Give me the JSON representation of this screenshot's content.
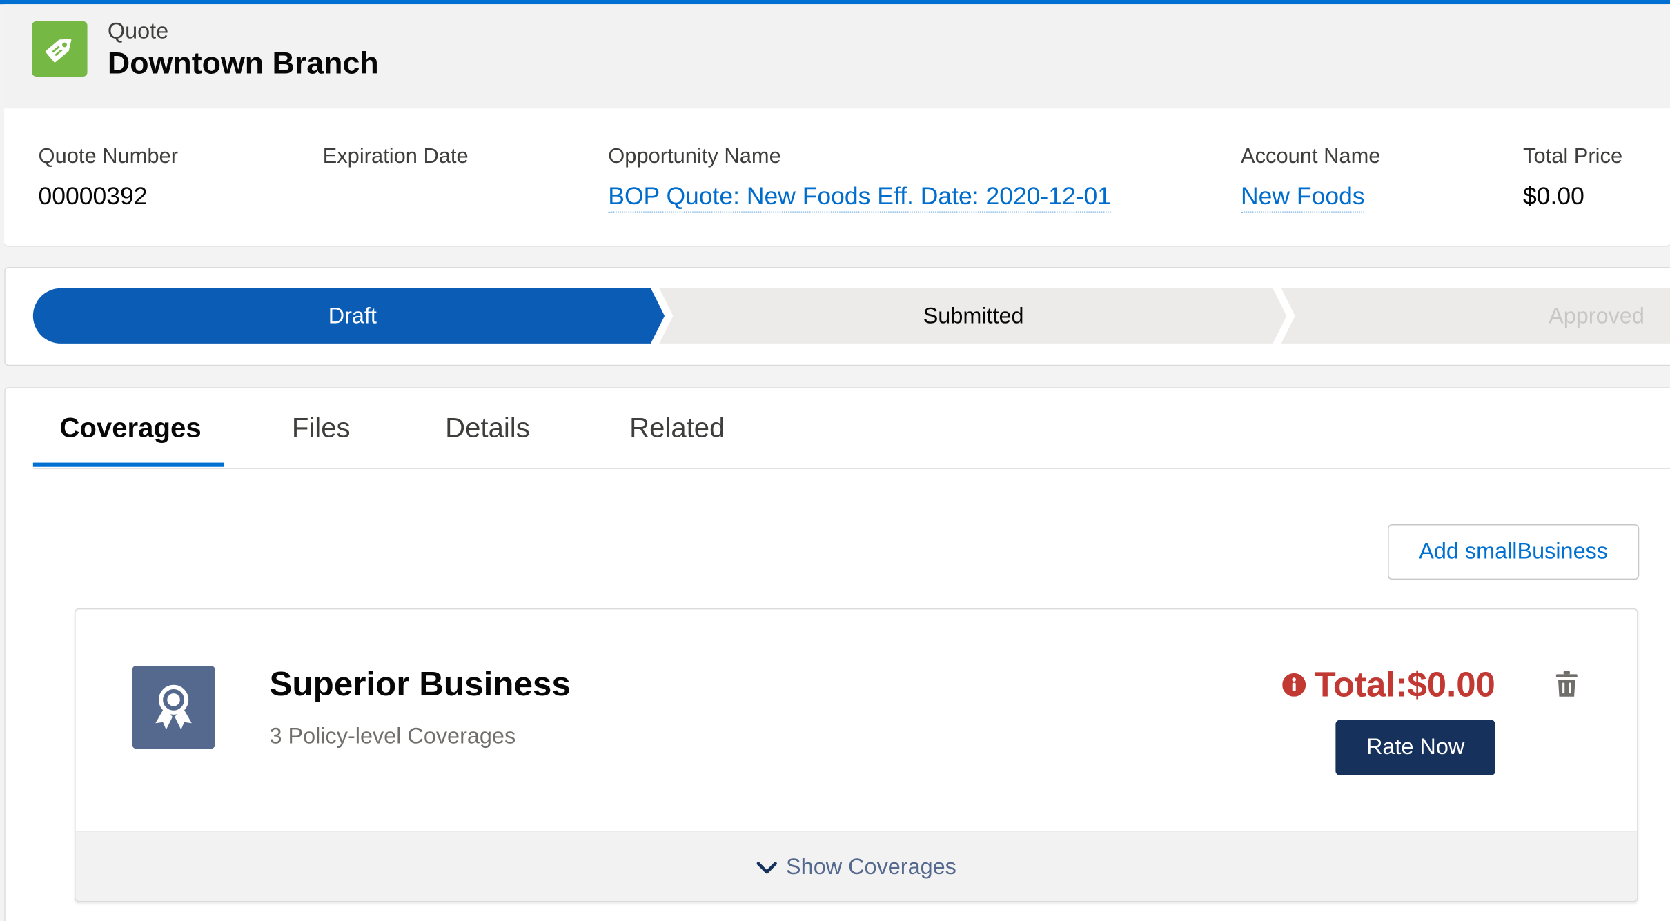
{
  "header": {
    "object_type": "Quote",
    "title": "Downtown Branch",
    "icon": "price-tag-icon",
    "icon_color": "#76b844"
  },
  "highlights": {
    "fields": [
      {
        "label": "Quote Number",
        "value": "00000392"
      },
      {
        "label": "Expiration Date",
        "value": ""
      },
      {
        "label": "Opportunity Name",
        "value": "BOP Quote: New Foods Eff. Date: 2020-12-01"
      },
      {
        "label": "Account Name",
        "value": "New Foods"
      },
      {
        "label": "Total Price",
        "value": "$0.00"
      }
    ]
  },
  "path": {
    "stages": [
      {
        "label": "Draft",
        "state": "current"
      },
      {
        "label": "Submitted",
        "state": "incomplete"
      },
      {
        "label": "Approved",
        "state": "incomplete"
      }
    ],
    "active_color": "#0b5cb5",
    "inactive_color": "#ecebea"
  },
  "tabs": {
    "items": [
      "Coverages",
      "Files",
      "Details",
      "Related"
    ],
    "active": "Coverages"
  },
  "actions": {
    "add_label": "Add smallBusiness"
  },
  "policy": {
    "name": "Superior Business",
    "subtitle": "3 Policy-level Coverages",
    "total": "Total:$0.00",
    "total_color": "#c23934",
    "rate_label": "Rate Now",
    "show_label": "Show Coverages",
    "icon": "award-ribbon-icon",
    "icon_color": "#54698d"
  },
  "colors": {
    "brand": "#0070d2",
    "rate_button": "#16325c"
  }
}
